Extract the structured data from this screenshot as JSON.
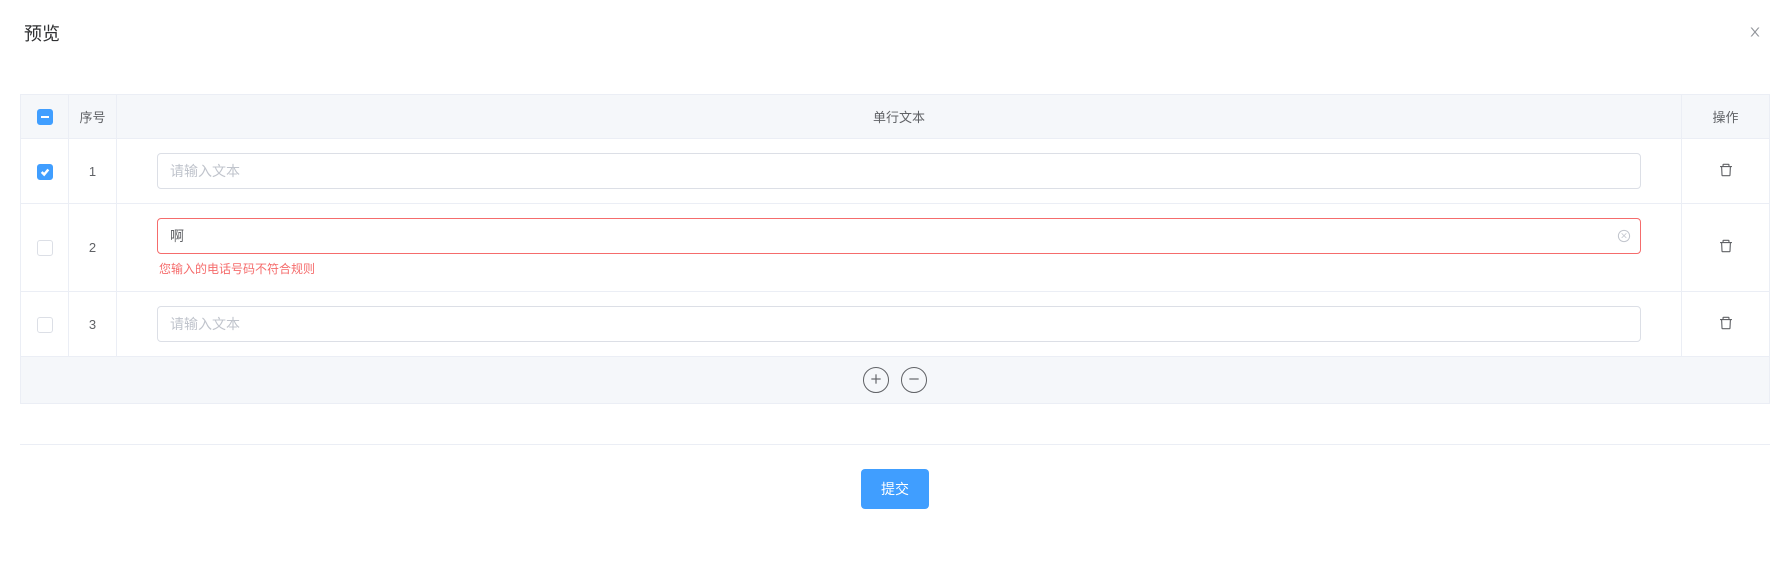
{
  "header": {
    "title": "预览"
  },
  "table": {
    "columns": {
      "index": "序号",
      "text": "单行文本",
      "action": "操作"
    },
    "placeholder": "请输入文本",
    "rows": [
      {
        "index": "1",
        "value": "",
        "checked": true,
        "error": null
      },
      {
        "index": "2",
        "value": "啊",
        "checked": false,
        "error": "您输入的电话号码不符合规则"
      },
      {
        "index": "3",
        "value": "",
        "checked": false,
        "error": null
      }
    ]
  },
  "actions": {
    "submit": "提交"
  }
}
